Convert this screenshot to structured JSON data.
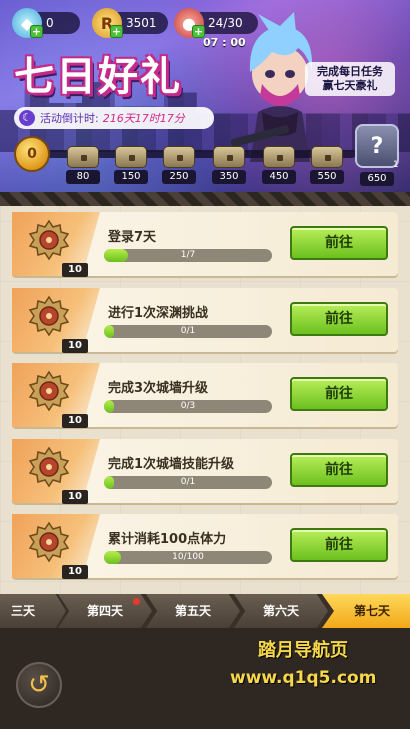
{
  "currencies": [
    {
      "name": "gem",
      "value": "0",
      "icon": "gem-icon"
    },
    {
      "name": "gold",
      "value": "3501",
      "icon": "gold-coin-icon"
    },
    {
      "name": "stamina",
      "value": "24/30",
      "icon": "meat-icon"
    }
  ],
  "stamina_timer": "07 : 00",
  "event": {
    "title": "七日好礼",
    "countdown_label": "活动倒计时:",
    "countdown_value": "216天17时17分",
    "quest_note_line1": "完成每日任务",
    "quest_note_line2": "赢七天豪礼",
    "points": "0",
    "reward_count": "1"
  },
  "milestones": [
    "80",
    "150",
    "250",
    "350",
    "450",
    "550",
    "650"
  ],
  "quests": [
    {
      "name": "登录7天",
      "progress": "1/7",
      "fraction": 0.143,
      "reward_qty": "10",
      "button": "前往"
    },
    {
      "name": "进行1次深渊挑战",
      "progress": "0/1",
      "fraction": 0,
      "reward_qty": "10",
      "button": "前往"
    },
    {
      "name": "完成3次城墙升级",
      "progress": "0/3",
      "fraction": 0,
      "reward_qty": "10",
      "button": "前往"
    },
    {
      "name": "完成1次城墙技能升级",
      "progress": "0/1",
      "fraction": 0,
      "reward_qty": "10",
      "button": "前往"
    },
    {
      "name": "累计消耗100点体力",
      "progress": "10/100",
      "fraction": 0.1,
      "reward_qty": "10",
      "button": "前往"
    }
  ],
  "days": [
    "三天",
    "第四天",
    "第五天",
    "第六天",
    "第七天"
  ],
  "active_day_index": 4,
  "watermark": {
    "line1": "踏月导航页",
    "line2": "www.q1q5.com"
  },
  "colors": {
    "accent_green": "#6cc01e",
    "accent_gold": "#f2a818",
    "title_pink": "#c42a8a"
  }
}
